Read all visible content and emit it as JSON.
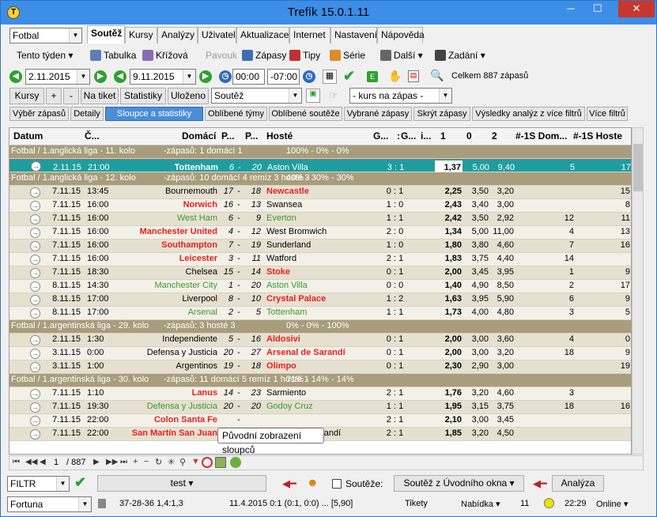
{
  "window": {
    "title": "Trefík 15.0.1.11",
    "min": "─",
    "max": "☐",
    "close": "✕"
  },
  "sport": "Fotbal",
  "tabs": [
    "Soutěž",
    "Kursy",
    "Analýzy",
    "Uživatel",
    "Aktualizace",
    "Internet",
    "Nastavení",
    "Nápověda"
  ],
  "toolbar": {
    "week": "Tento týden",
    "tabulka": "Tabulka",
    "krizova": "Křížová",
    "pavouk": "Pavouk",
    "zapasy": "Zápasy",
    "tipy": "Tipy",
    "serie": "Série",
    "dalsi": "Další",
    "zadani": "Zadání"
  },
  "filter": {
    "date_from": "2.11.2015",
    "date_to": "9.11.2015",
    "time_from": "00:00",
    "time_to": "-07:00",
    "total": "Celkem 887 zápasů"
  },
  "row3": {
    "kursy": "Kursy",
    "plus": "+",
    "minus": "-",
    "na_tiket": "Na tiket",
    "statistiky": "Statistiky",
    "ulozeno": "Uloženo",
    "soutez": "Soutěž",
    "kurs": "- kurs na zápas -"
  },
  "subtabs": [
    "Výběr zápasů",
    "Detaily",
    "Sloupce a statistiky",
    "Oblíbené týmy",
    "Oblíbené soutěže",
    "Vybrané zápasy",
    "Skrýt zápasy",
    "Výsledky analýz z více filtrů",
    "Více filtrů"
  ],
  "columns": [
    "Datum",
    "Č...",
    "Domácí",
    "P...",
    "P...",
    "Hosté",
    "G...",
    ":",
    "G...",
    "i...",
    "1",
    "0",
    "2",
    "#-1S Dom...",
    "#-1S Hoste"
  ],
  "groups": [
    {
      "label": "Fotbal / 1.anglická liga - 11. kolo",
      "stats": "-zápasů: 1      domácí 1",
      "pct": "100% - 0% - 0%"
    },
    {
      "label": "Fotbal / 1.anglická liga - 12. kolo",
      "stats": "-zápasů: 10      domácí 4      remíz 3      hosté 3",
      "pct": "40% - 30% - 30%"
    },
    {
      "label": "Fotbal / 1.argentinská liga - 29. kolo",
      "stats": "-zápasů: 3            hosté 3",
      "pct": "0% - 0% - 100%"
    },
    {
      "label": "Fotbal / 1.argentinská liga - 30. kolo",
      "stats": "-zápasů: 11      domácí 5      remíz 1      hosté 1",
      "pct": "71% - 14% - 14%"
    }
  ],
  "rows": [
    {
      "d": "2.11.15",
      "t": "21:00",
      "h": "Tottenham",
      "p1": "6",
      "p2": "20",
      "a": "Aston Villa",
      "s": "3 : 1",
      "o1": "1,37",
      "o0": "5,00",
      "o2": "9,40",
      "dh": "5",
      "da": "17",
      "hc": "b",
      "ac": ""
    },
    {
      "d": "7.11.15",
      "t": "13:45",
      "h": "Bournemouth",
      "p1": "17",
      "p2": "18",
      "a": "Newcastle",
      "s": "0 : 1",
      "o1": "2,25",
      "o0": "3,50",
      "o2": "3,20",
      "dh": "",
      "da": "15",
      "hc": "",
      "ac": "red"
    },
    {
      "d": "7.11.15",
      "t": "16:00",
      "h": "Norwich",
      "p1": "16",
      "p2": "13",
      "a": "Swansea",
      "s": "1 : 0",
      "o1": "2,43",
      "o0": "3,40",
      "o2": "3,00",
      "dh": "",
      "da": "8",
      "hc": "red",
      "ac": ""
    },
    {
      "d": "7.11.15",
      "t": "16:00",
      "h": "West Ham",
      "p1": "6",
      "p2": "9",
      "a": "Everton",
      "s": "1 : 1",
      "o1": "2,42",
      "o0": "3,50",
      "o2": "2,92",
      "dh": "12",
      "da": "11",
      "hc": "grn",
      "ac": "grn"
    },
    {
      "d": "7.11.15",
      "t": "16:00",
      "h": "Manchester United",
      "p1": "4",
      "p2": "12",
      "a": "West Bromwich",
      "s": "2 : 0",
      "o1": "1,34",
      "o0": "5,00",
      "o2": "11,00",
      "dh": "4",
      "da": "13",
      "hc": "red",
      "ac": ""
    },
    {
      "d": "7.11.15",
      "t": "16:00",
      "h": "Southampton",
      "p1": "7",
      "p2": "19",
      "a": "Sunderland",
      "s": "1 : 0",
      "o1": "1,80",
      "o0": "3,80",
      "o2": "4,60",
      "dh": "7",
      "da": "16",
      "hc": "red",
      "ac": ""
    },
    {
      "d": "7.11.15",
      "t": "16:00",
      "h": "Leicester",
      "p1": "3",
      "p2": "11",
      "a": "Watford",
      "s": "2 : 1",
      "o1": "1,83",
      "o0": "3,75",
      "o2": "4,40",
      "dh": "14",
      "da": "",
      "hc": "red",
      "ac": ""
    },
    {
      "d": "7.11.15",
      "t": "18:30",
      "h": "Chelsea",
      "p1": "15",
      "p2": "14",
      "a": "Stoke",
      "s": "0 : 1",
      "o1": "2,00",
      "o0": "3,45",
      "o2": "3,95",
      "dh": "1",
      "da": "9",
      "hc": "",
      "ac": "red"
    },
    {
      "d": "8.11.15",
      "t": "14:30",
      "h": "Manchester City",
      "p1": "1",
      "p2": "20",
      "a": "Aston Villa",
      "s": "0 : 0",
      "o1": "1,40",
      "o0": "4,90",
      "o2": "8,50",
      "dh": "2",
      "da": "17",
      "hc": "grn",
      "ac": "grn"
    },
    {
      "d": "8.11.15",
      "t": "17:00",
      "h": "Liverpool",
      "p1": "8",
      "p2": "10",
      "a": "Crystal Palace",
      "s": "1 : 2",
      "o1": "1,63",
      "o0": "3,95",
      "o2": "5,90",
      "dh": "6",
      "da": "9",
      "hc": "",
      "ac": "red"
    },
    {
      "d": "8.11.15",
      "t": "17:00",
      "h": "Arsenal",
      "p1": "2",
      "p2": "5",
      "a": "Tottenham",
      "s": "1 : 1",
      "o1": "1,73",
      "o0": "4,00",
      "o2": "4,80",
      "dh": "3",
      "da": "5",
      "hc": "grn",
      "ac": "grn"
    },
    {
      "d": "2.11.15",
      "t": "1:30",
      "h": "Independiente",
      "p1": "5",
      "p2": "16",
      "a": "Aldosivi",
      "s": "0 : 1",
      "o1": "2,00",
      "o0": "3,00",
      "o2": "3,60",
      "dh": "4",
      "da": "0",
      "hc": "",
      "ac": "red"
    },
    {
      "d": "3.11.15",
      "t": "0:00",
      "h": "Defensa y Justicia",
      "p1": "20",
      "p2": "27",
      "a": "Arsenal de Sarandí",
      "s": "0 : 1",
      "o1": "2,00",
      "o0": "3,00",
      "o2": "3,20",
      "dh": "18",
      "da": "9",
      "hc": "",
      "ac": "red"
    },
    {
      "d": "3.11.15",
      "t": "1:00",
      "h": "Argentinos",
      "p1": "19",
      "p2": "18",
      "a": "Olimpo",
      "s": "0 : 1",
      "o1": "2,30",
      "o0": "2,90",
      "o2": "3,00",
      "dh": "",
      "da": "19",
      "hc": "",
      "ac": "red"
    },
    {
      "d": "7.11.15",
      "t": "1:10",
      "h": "Lanus",
      "p1": "14",
      "p2": "23",
      "a": "Sarmiento",
      "s": "2 : 1",
      "o1": "1,76",
      "o0": "3,20",
      "o2": "4,60",
      "dh": "3",
      "da": "",
      "hc": "red",
      "ac": ""
    },
    {
      "d": "7.11.15",
      "t": "19:30",
      "h": "Defensa y Justicia",
      "p1": "20",
      "p2": "20",
      "a": "Godoy Cruz",
      "s": "1 : 1",
      "o1": "1,95",
      "o0": "3,15",
      "o2": "3,75",
      "dh": "18",
      "da": "16",
      "hc": "grn",
      "ac": "grn"
    },
    {
      "d": "7.11.15",
      "t": "22:00",
      "h": "Colon Santa Fe",
      "p1": "",
      "p2": "",
      "a": "",
      "s": "2 : 1",
      "o1": "2,10",
      "o0": "3,00",
      "o2": "3,45",
      "dh": "",
      "da": "",
      "hc": "red",
      "ac": ""
    },
    {
      "d": "7.11.15",
      "t": "22:00",
      "h": "San Martín San Juan",
      "p1": "",
      "p2": "27",
      "a": "Arsenal de Sarandí",
      "s": "2 : 1",
      "o1": "1,85",
      "o0": "3,20",
      "o2": "4,50",
      "dh": "",
      "da": "",
      "hc": "red",
      "ac": ""
    }
  ],
  "pager": {
    "page": "1",
    "total": "/ 887"
  },
  "tooltip": "Původní zobrazení sloupců",
  "bottom": {
    "filtr": "FILTR",
    "test": "test",
    "soutezecb": "Soutěže:",
    "soutez_okna": "Soutěž z Úvodního okna",
    "analyza": "Analýza"
  },
  "status": {
    "book": "Fortuna",
    "rec": "37-28-36  1,4:1,3",
    "match": "11.4.2015 0:1 (0:1, 0:0) ... [5,90]",
    "tikety": "Tikety",
    "nabidka": "Nabídka",
    "num": "11",
    "time": "22:29",
    "online": "Online"
  }
}
